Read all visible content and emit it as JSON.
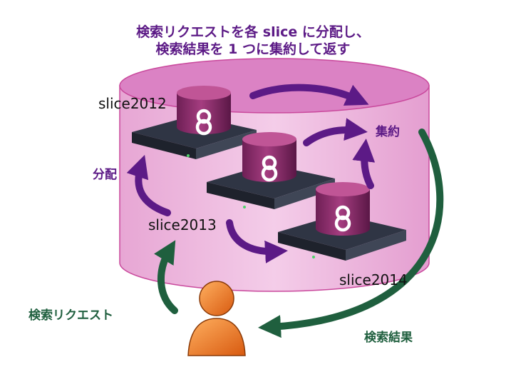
{
  "title": {
    "line1": "検索リクエストを各 slice に分配し、",
    "line2": "検索結果を 1 つに集約して返す"
  },
  "labels": {
    "slice2012": "slice2012",
    "slice2013": "slice2013",
    "slice2014": "slice2014",
    "distribute": "分配",
    "aggregate": "集約",
    "search_request": "検索リクエスト",
    "search_result": "検索結果"
  },
  "colors": {
    "cylinder": "#e9a7d6",
    "cylinder_top": "#d77ac0",
    "purple_arrow": "#5c1a86",
    "green_arrow": "#1f5f3e",
    "database": "#8c2f6a",
    "person": "#e8741e"
  },
  "icons": {
    "server": "server-rack-icon",
    "database": "database-icon",
    "user": "user-icon"
  }
}
